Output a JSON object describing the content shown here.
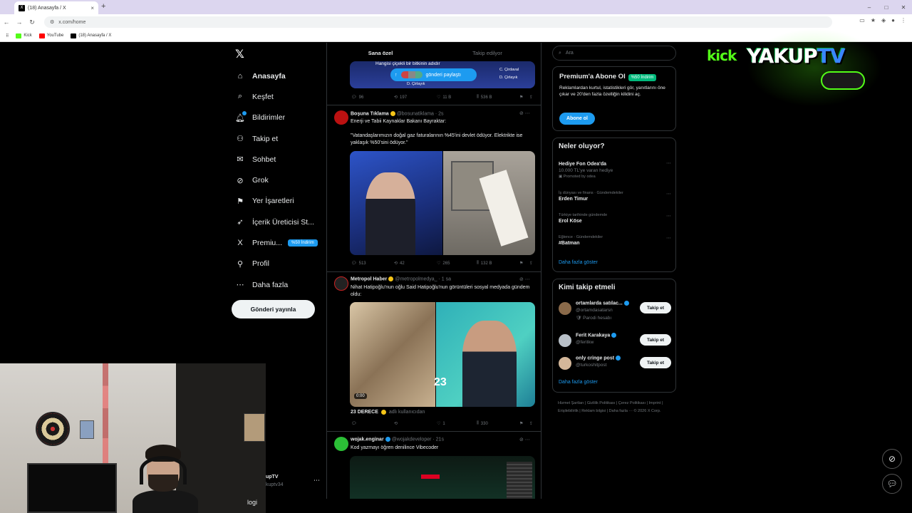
{
  "browser": {
    "tab_title": "(18) Anasayfa / X",
    "tab_close": "×",
    "new_tab": "+",
    "url": "x.com/home",
    "win_min": "–",
    "win_max": "□",
    "win_close": "✕",
    "bookmarks": [
      {
        "label": "Kick",
        "color": "#53fc18"
      },
      {
        "label": "YouTube",
        "color": "#ff0000"
      },
      {
        "label": "(18) Anasayfa / X",
        "color": "#000000"
      }
    ]
  },
  "nav": {
    "items": [
      {
        "label": "Anasayfa",
        "icon": "⌂"
      },
      {
        "label": "Keşfet",
        "icon": "⌕"
      },
      {
        "label": "Bildirimler",
        "icon": "♫"
      },
      {
        "label": "Takip et",
        "icon": "⚇"
      },
      {
        "label": "Sohbet",
        "icon": "✉"
      },
      {
        "label": "Grok",
        "icon": "⊘"
      },
      {
        "label": "Yer İşaretleri",
        "icon": "⚑"
      },
      {
        "label": "İçerik Üreticisi St...",
        "icon": "➶"
      },
      {
        "label": "Premiu...",
        "icon": "X"
      },
      {
        "label": "Profil",
        "icon": "⚲"
      },
      {
        "label": "Daha fazla",
        "icon": "⋯"
      }
    ],
    "premium_badge": "%50 İndirim",
    "post_button": "Gönderi yayınla",
    "account_name": "upTV",
    "account_handle": "kuptv34",
    "account_more": "⋯",
    "logi": "logi"
  },
  "feed": {
    "tabs": [
      "Sana özel",
      "Takip edilyor"
    ],
    "repost_pill": "gönderi paylaştı",
    "top_image_caption": "Hangisi çiçekli bir bitkinin adıdır",
    "top_opts": [
      "C. Çirdaval",
      "D. Çirlayık",
      "D. Çirlayık"
    ],
    "top_acts": [
      "96",
      "197",
      "11 B",
      "536 B"
    ],
    "tweets": [
      {
        "name": "Boşuna Tıklama",
        "meta": "@bosunatiklama · 2s",
        "line1": "Enerji ve Tabii Kaynaklar Bakanı Bayraktar:",
        "line2": "\"Vatandaşlarımızın doğal gaz faturalarının %45'ini devlet ödüyor. Elektrikte ise yaklaşık %50'sini ödüyor.\"",
        "acts": [
          "513",
          "42",
          "265",
          "132 B"
        ]
      },
      {
        "name": "Metropol Haber",
        "meta": "@metropolmedya_ · 1 sa",
        "text": "Nihat Hatipoğlu'nun oğlu Said Hatipoğlu'nun görüntüleri sosyal medyada gündem oldu:",
        "duration": "0:00",
        "logo_text": "23",
        "caption": "23 DERECE",
        "caption_meta": "adlı kullanıcıdan",
        "acts": [
          "",
          "",
          "1",
          "330"
        ]
      },
      {
        "name": "wojak.enginar",
        "meta": "@wojakdeveloper · 21s",
        "text": "Kod yazmayı öğren denilince Vibecoder"
      }
    ]
  },
  "right": {
    "search_placeholder": "Ara",
    "premium": {
      "title": "Premium'a Abone Ol",
      "badge": "%50 İndirim",
      "desc": "Reklamlardan kurtul, istatistikleri gör, yanıtlarını öne çıkar ve 20'den fazla özelliğin kilidini aç.",
      "button": "Abone ol"
    },
    "trends_title": "Neler oluyor?",
    "trends": [
      {
        "cat": "",
        "title": "Hediye Fon Odea'da",
        "sub": "10.000 TL'ye varan hediye",
        "promo": "Promoted by odea"
      },
      {
        "cat": "İş dünyası ve finans · Gündemdekiler",
        "title": "Erden Timur",
        "sub": "",
        "promo": ""
      },
      {
        "cat": "Türkiye tarihinde gündemde",
        "title": "Erol Köse",
        "sub": "",
        "promo": ""
      },
      {
        "cat": "Eğlence · Gündemdekiler",
        "title": "#Batman",
        "sub": "",
        "promo": ""
      }
    ],
    "trends_more": "Daha fazla göster",
    "wtf_title": "Kimi takip etmeli",
    "wtf": [
      {
        "name": "ortamlarda satılac...",
        "handle": "@ortamdasatarsn",
        "parody": "Parodi hesabı"
      },
      {
        "name": "Ferit Karakaya",
        "handle": "@feritkw",
        "parody": ""
      },
      {
        "name": "only cringe post",
        "handle": "@turkoshitpost",
        "parody": ""
      }
    ],
    "follow_label": "Takip et",
    "wtf_more": "Daha fazla göster",
    "footer": "Hizmet Şartları  |  Gizlilik Politikası  |  Çerez Politikası  |  Imprint  |  Erişilebilirlik  |  Reklam bilgisi  |  Daha fazla ⋯  © 2026 X Corp."
  },
  "overlay": {
    "kick": "kick",
    "yakup": "YAKUP",
    "tv": "TV"
  },
  "colors": {
    "accent": "#1d9bf0",
    "bg": "#000000",
    "kick": "#53fc18",
    "premium": "#00ba7c"
  }
}
